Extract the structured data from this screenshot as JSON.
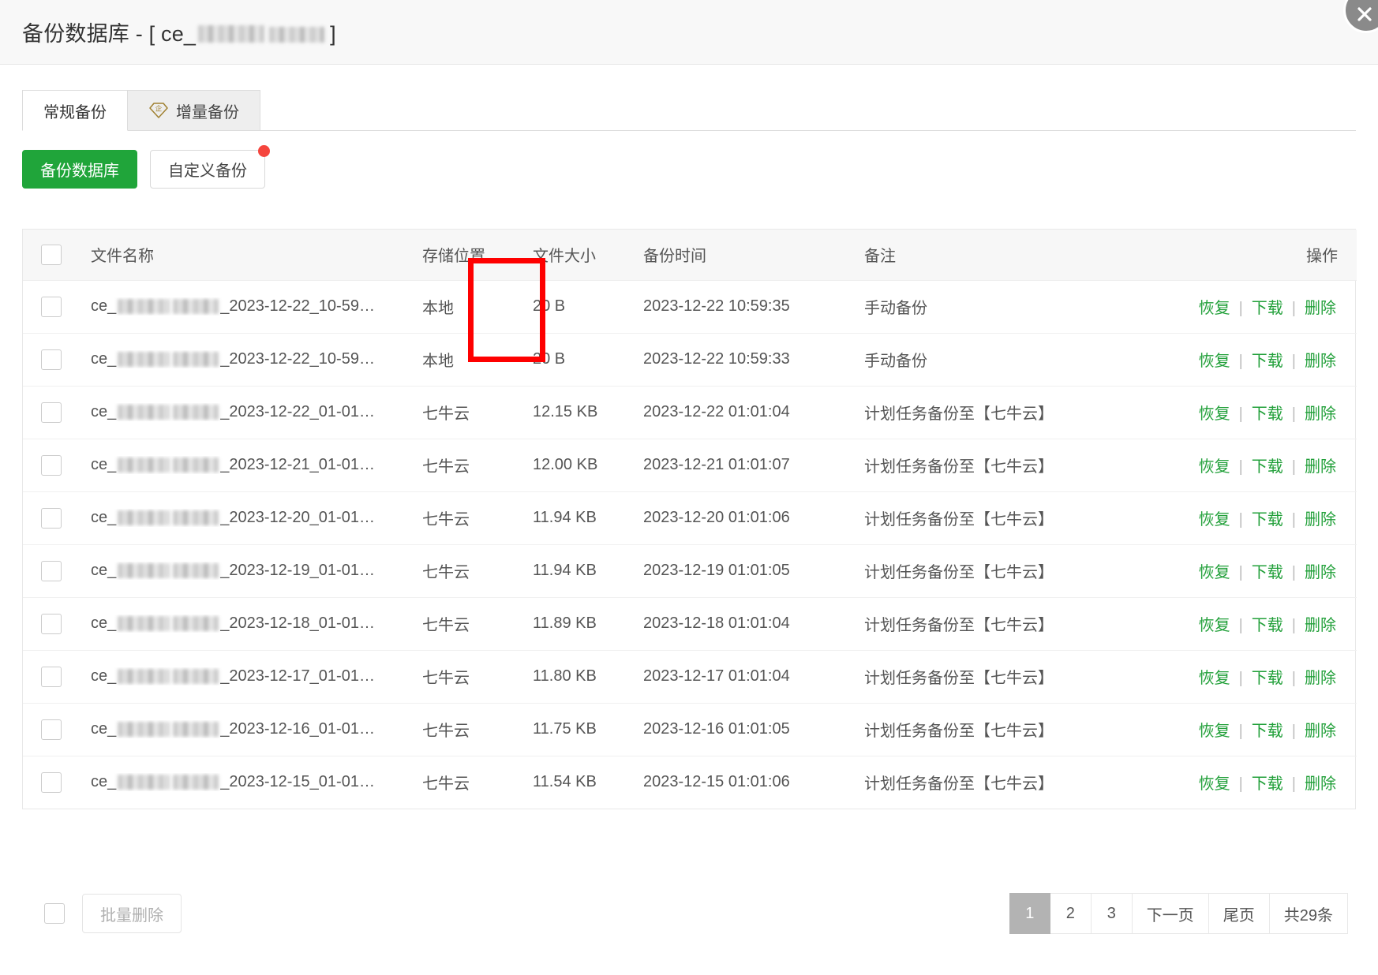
{
  "dialog": {
    "title_prefix": "备份数据库 - [ ce_",
    "title_suffix": "]",
    "close_icon": "close-icon"
  },
  "tabs": [
    {
      "label": "常规备份",
      "active": true,
      "icon": null
    },
    {
      "label": "增量备份",
      "active": false,
      "icon": "enterprise-gem-icon"
    }
  ],
  "toolbar": {
    "backup_button": "备份数据库",
    "custom_backup_button": "自定义备份",
    "has_new_badge": true
  },
  "table": {
    "columns": {
      "select": "",
      "name": "文件名称",
      "location": "存储位置",
      "size": "文件大小",
      "time": "备份时间",
      "note": "备注",
      "operation": "操作"
    },
    "actions": {
      "restore": "恢复",
      "download": "下载",
      "delete": "删除",
      "separator": "|"
    },
    "name_prefix": "ce_",
    "rows": [
      {
        "name_suffix": "_2023-12-22_10-59…",
        "location": "本地",
        "size": "20 B",
        "time": "2023-12-22 10:59:35",
        "note": "手动备份"
      },
      {
        "name_suffix": "_2023-12-22_10-59…",
        "location": "本地",
        "size": "20 B",
        "time": "2023-12-22 10:59:33",
        "note": "手动备份"
      },
      {
        "name_suffix": "_2023-12-22_01-01…",
        "location": "七牛云",
        "size": "12.15 KB",
        "time": "2023-12-22 01:01:04",
        "note": "计划任务备份至【七牛云】"
      },
      {
        "name_suffix": "_2023-12-21_01-01…",
        "location": "七牛云",
        "size": "12.00 KB",
        "time": "2023-12-21 01:01:07",
        "note": "计划任务备份至【七牛云】"
      },
      {
        "name_suffix": "_2023-12-20_01-01…",
        "location": "七牛云",
        "size": "11.94 KB",
        "time": "2023-12-20 01:01:06",
        "note": "计划任务备份至【七牛云】"
      },
      {
        "name_suffix": "_2023-12-19_01-01…",
        "location": "七牛云",
        "size": "11.94 KB",
        "time": "2023-12-19 01:01:05",
        "note": "计划任务备份至【七牛云】"
      },
      {
        "name_suffix": "_2023-12-18_01-01…",
        "location": "七牛云",
        "size": "11.89 KB",
        "time": "2023-12-18 01:01:04",
        "note": "计划任务备份至【七牛云】"
      },
      {
        "name_suffix": "_2023-12-17_01-01…",
        "location": "七牛云",
        "size": "11.80 KB",
        "time": "2023-12-17 01:01:04",
        "note": "计划任务备份至【七牛云】"
      },
      {
        "name_suffix": "_2023-12-16_01-01…",
        "location": "七牛云",
        "size": "11.75 KB",
        "time": "2023-12-16 01:01:05",
        "note": "计划任务备份至【七牛云】"
      },
      {
        "name_suffix": "_2023-12-15_01-01…",
        "location": "七牛云",
        "size": "11.54 KB",
        "time": "2023-12-15 01:01:06",
        "note": "计划任务备份至【七牛云】"
      }
    ]
  },
  "footer": {
    "batch_delete": "批量删除",
    "pages": [
      "1",
      "2",
      "3"
    ],
    "current_page": "1",
    "next_page": "下一页",
    "last_page": "尾页",
    "total": "共29条"
  },
  "annotation": {
    "color": "#fe0000",
    "target": "file-size-column-cells"
  },
  "colors": {
    "primary_green": "#20a53a",
    "link_green": "#22a03a",
    "badge_red": "#f5453d",
    "annotation_red": "#fe0000",
    "gem_gold": "#a08030"
  }
}
